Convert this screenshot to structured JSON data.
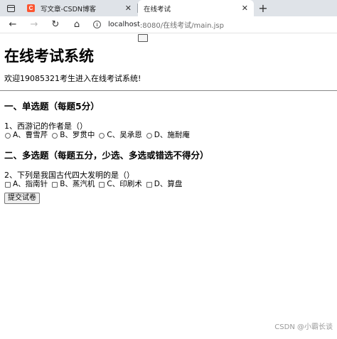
{
  "browser": {
    "tabs": [
      {
        "title": "写文章-CSDN博客",
        "icon": "csdn-icon",
        "icon_text": "C",
        "active": false
      },
      {
        "title": "在线考试",
        "icon": "page-icon",
        "active": true
      }
    ],
    "close_glyph": "✕",
    "new_tab_glyph": "+",
    "nav": {
      "back": "←",
      "forward": "→",
      "reload": "↻",
      "home": "⌂"
    },
    "url_host": "localhost",
    "url_path": ":8080/在线考试/main.jsp",
    "info_glyph": "i"
  },
  "page": {
    "title": "在线考试系统",
    "welcome": "欢迎19085321考生进入在线考试系统!",
    "section1": {
      "heading": "一、单选题（每题5分）",
      "question": "1、西游记的作者是（）",
      "options": [
        "A、曹雪芹",
        "B、罗贯中",
        "C、吴承恩",
        "D、施耐庵"
      ]
    },
    "section2": {
      "heading": "二、多选题（每题五分，少选、多选或错选不得分）",
      "question": "2、下列是我国古代四大发明的是（）",
      "options": [
        "A、指南针",
        "B、蒸汽机",
        "C、印刷术",
        "D、算盘"
      ]
    },
    "submit_label": "提交试卷"
  },
  "watermark": "CSDN @小霸长谈"
}
